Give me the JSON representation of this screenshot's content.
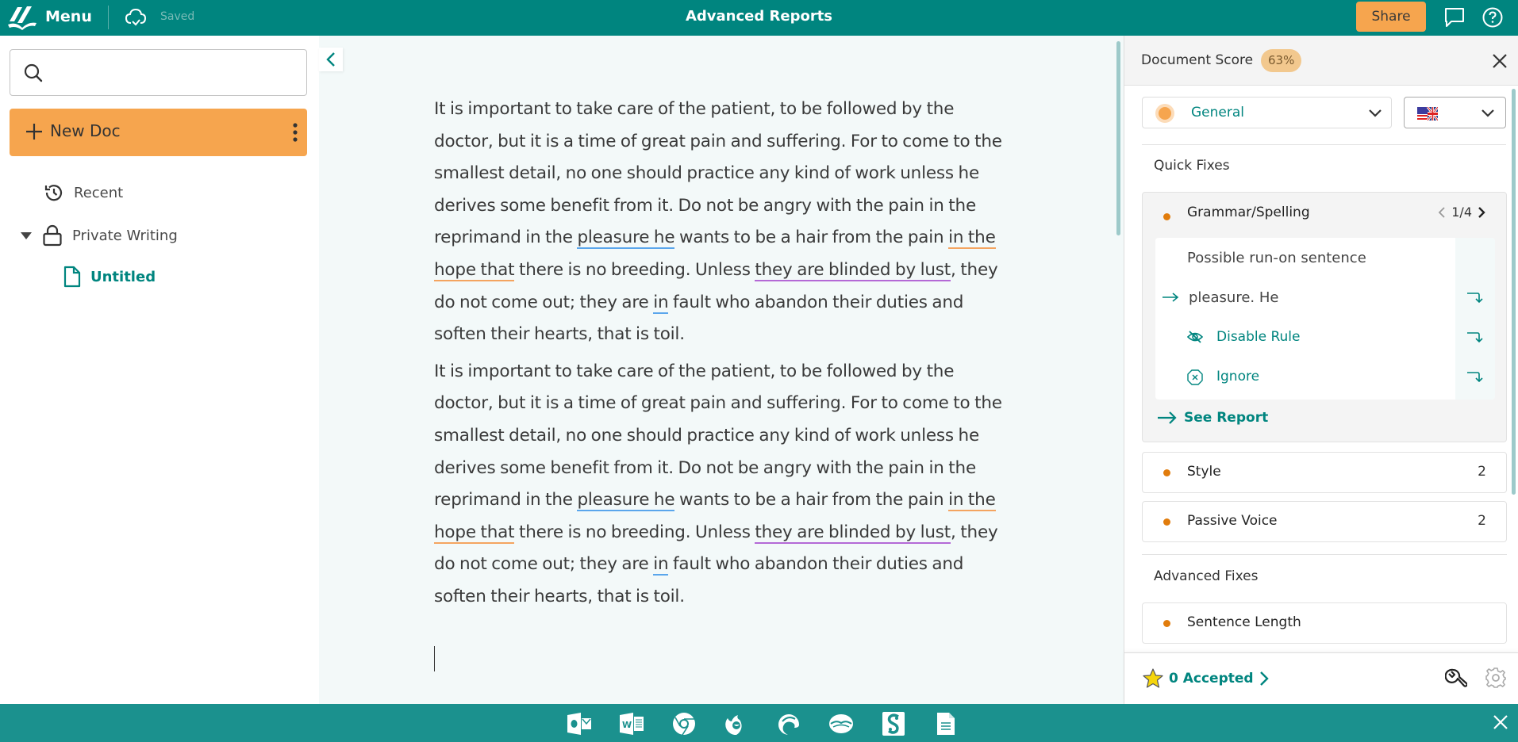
{
  "header": {
    "menu_label": "Menu",
    "save_status": "Saved",
    "title": "Advanced Reports",
    "share_label": "Share"
  },
  "sidebar": {
    "search": {
      "value": "",
      "placeholder": ""
    },
    "new_doc_label": "New Doc",
    "nav": [
      {
        "label": "Recent",
        "icon": "history-icon"
      },
      {
        "label": "Private Writing",
        "icon": "lock-icon",
        "expanded": true
      },
      {
        "label": "Untitled",
        "icon": "document-icon",
        "active": true
      }
    ]
  },
  "editor": {
    "paragraphs": [
      {
        "segments": [
          {
            "text": "It is important to take care of the patient, to be followed by the doctor, but it is a time of great pain and suffering. For to come to the smallest detail, no one should practice any kind of work unless he derives some benefit from it. Do not be angry with the pain in the reprimand in the "
          },
          {
            "text": "pleasure he",
            "mark": "grammar"
          },
          {
            "text": " wants to be a hair from the pain "
          },
          {
            "text": "in the hope that",
            "mark": "style"
          },
          {
            "text": " there is no breeding. Unless "
          },
          {
            "text": "they are blinded by lust",
            "mark": "passive"
          },
          {
            "text": ", they do not come out; they are "
          },
          {
            "text": "in",
            "mark": "grammar"
          },
          {
            "text": " fault who abandon their duties and soften their hearts, that is toil."
          }
        ]
      },
      {
        "segments": [
          {
            "text": "It is important to take care of the patient, to be followed by the doctor, but it is a time of great pain and suffering. For to come to the smallest detail, no one should practice any kind of work unless he derives some benefit from it. Do not be angry with the pain in the reprimand in the "
          },
          {
            "text": "pleasure he",
            "mark": "grammar"
          },
          {
            "text": " wants to be a hair from the pain "
          },
          {
            "text": "in the hope that",
            "mark": "style"
          },
          {
            "text": " there is no breeding. Unless "
          },
          {
            "text": "they are blinded by lust",
            "mark": "passive"
          },
          {
            "text": ", they do not come out; they are "
          },
          {
            "text": "in",
            "mark": "grammar"
          },
          {
            "text": " fault who abandon their duties and soften their hearts, that is toil."
          }
        ]
      }
    ],
    "mark_colors": {
      "grammar": "#5aa6ec",
      "style": "#f4a460",
      "passive": "#b469d6"
    }
  },
  "panel": {
    "title": "Document Score",
    "score": "63%",
    "style_select": "General",
    "language_select": "English (US/UK flag)",
    "quick_fixes_label": "Quick Fixes",
    "grammar": {
      "name": "Grammar/Spelling",
      "pager": "1/4",
      "suggestion_title": "Possible run-on sentence",
      "fix": "pleasure. He",
      "disable_label": "Disable Rule",
      "ignore_label": "Ignore",
      "see_report_label": "See Report"
    },
    "categories": [
      {
        "name": "Style",
        "count": "2"
      },
      {
        "name": "Passive Voice",
        "count": "2"
      }
    ],
    "advanced_fixes_label": "Advanced Fixes",
    "advanced": [
      {
        "name": "Sentence Length"
      }
    ],
    "accepted_label": "0 Accepted"
  },
  "dock": {
    "apps": [
      "outlook-icon",
      "word-icon",
      "chrome-icon",
      "firefox-icon",
      "edge-icon",
      "openoffice-icon",
      "scrivener-icon",
      "document-icon"
    ]
  },
  "colors": {
    "brand": "#00857f",
    "accent": "#f6a54e",
    "dock": "#1b918e",
    "issue_dot": "#e17c0c"
  }
}
